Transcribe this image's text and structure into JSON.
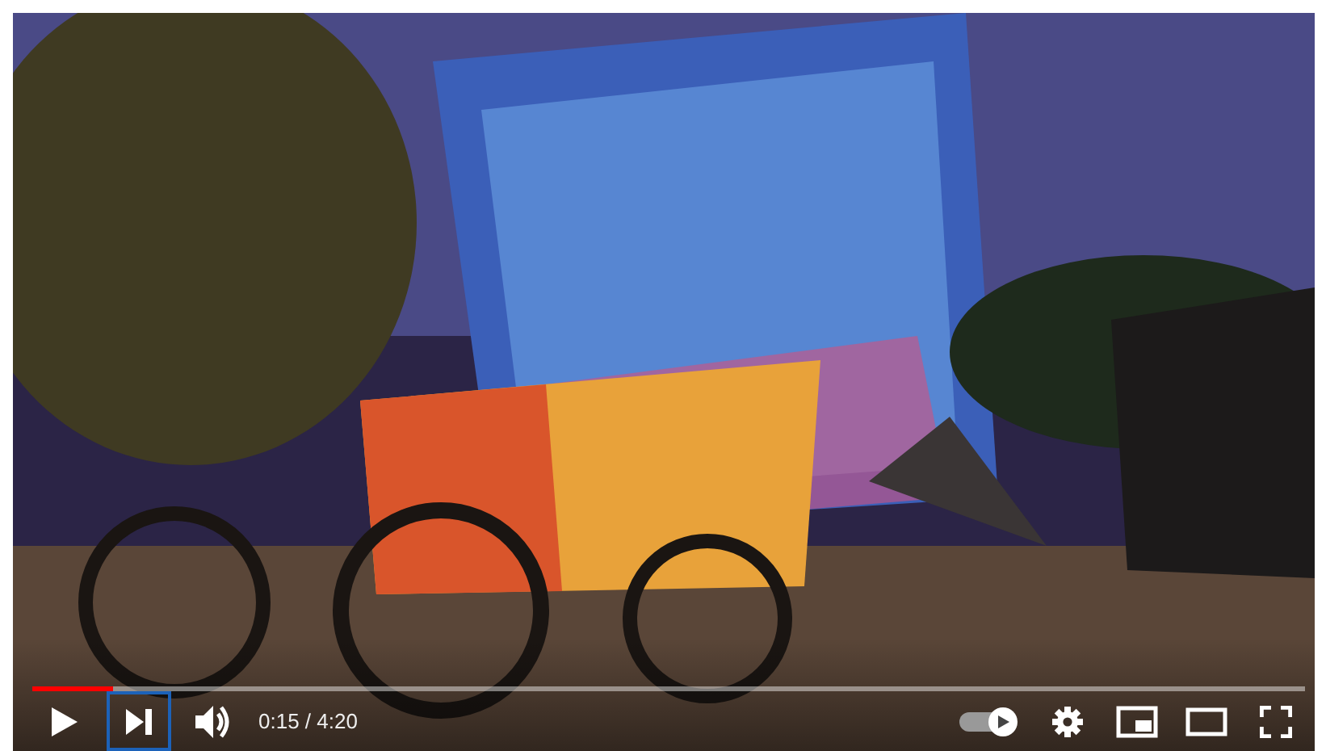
{
  "player": {
    "progress": {
      "level": 0.063
    },
    "controls": [
      {
        "kind": "play",
        "focused": false
      },
      {
        "kind": "next",
        "focused": true
      },
      {
        "kind": "volume",
        "focused": false
      }
    ],
    "time": "0:15 / 4:20",
    "autoplay": {
      "on": true
    },
    "right_controls": [
      {
        "kind": "settings"
      },
      {
        "kind": "miniplayer"
      },
      {
        "kind": "theater"
      },
      {
        "kind": "fullscreen"
      }
    ]
  }
}
